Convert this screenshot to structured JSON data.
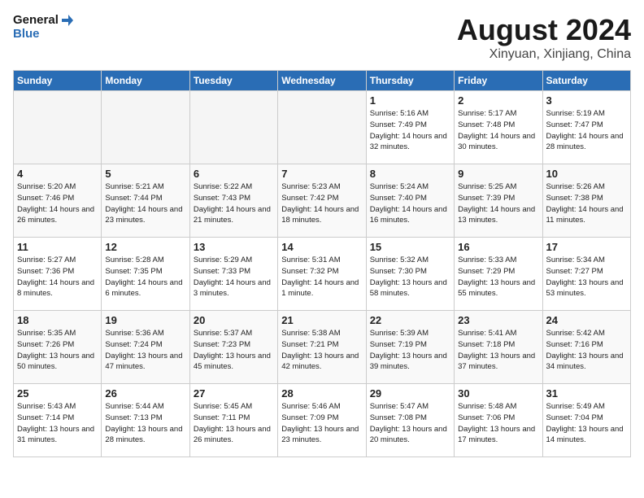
{
  "logo": {
    "line1": "General",
    "line2": "Blue"
  },
  "title": "August 2024",
  "location": "Xinyuan, Xinjiang, China",
  "weekdays": [
    "Sunday",
    "Monday",
    "Tuesday",
    "Wednesday",
    "Thursday",
    "Friday",
    "Saturday"
  ],
  "weeks": [
    [
      {
        "day": "",
        "empty": true
      },
      {
        "day": "",
        "empty": true
      },
      {
        "day": "",
        "empty": true
      },
      {
        "day": "",
        "empty": true
      },
      {
        "day": "1",
        "sunrise": "5:16 AM",
        "sunset": "7:49 PM",
        "daylight": "14 hours and 32 minutes."
      },
      {
        "day": "2",
        "sunrise": "5:17 AM",
        "sunset": "7:48 PM",
        "daylight": "14 hours and 30 minutes."
      },
      {
        "day": "3",
        "sunrise": "5:19 AM",
        "sunset": "7:47 PM",
        "daylight": "14 hours and 28 minutes."
      }
    ],
    [
      {
        "day": "4",
        "sunrise": "5:20 AM",
        "sunset": "7:46 PM",
        "daylight": "14 hours and 26 minutes."
      },
      {
        "day": "5",
        "sunrise": "5:21 AM",
        "sunset": "7:44 PM",
        "daylight": "14 hours and 23 minutes."
      },
      {
        "day": "6",
        "sunrise": "5:22 AM",
        "sunset": "7:43 PM",
        "daylight": "14 hours and 21 minutes."
      },
      {
        "day": "7",
        "sunrise": "5:23 AM",
        "sunset": "7:42 PM",
        "daylight": "14 hours and 18 minutes."
      },
      {
        "day": "8",
        "sunrise": "5:24 AM",
        "sunset": "7:40 PM",
        "daylight": "14 hours and 16 minutes."
      },
      {
        "day": "9",
        "sunrise": "5:25 AM",
        "sunset": "7:39 PM",
        "daylight": "14 hours and 13 minutes."
      },
      {
        "day": "10",
        "sunrise": "5:26 AM",
        "sunset": "7:38 PM",
        "daylight": "14 hours and 11 minutes."
      }
    ],
    [
      {
        "day": "11",
        "sunrise": "5:27 AM",
        "sunset": "7:36 PM",
        "daylight": "14 hours and 8 minutes."
      },
      {
        "day": "12",
        "sunrise": "5:28 AM",
        "sunset": "7:35 PM",
        "daylight": "14 hours and 6 minutes."
      },
      {
        "day": "13",
        "sunrise": "5:29 AM",
        "sunset": "7:33 PM",
        "daylight": "14 hours and 3 minutes."
      },
      {
        "day": "14",
        "sunrise": "5:31 AM",
        "sunset": "7:32 PM",
        "daylight": "14 hours and 1 minute."
      },
      {
        "day": "15",
        "sunrise": "5:32 AM",
        "sunset": "7:30 PM",
        "daylight": "13 hours and 58 minutes."
      },
      {
        "day": "16",
        "sunrise": "5:33 AM",
        "sunset": "7:29 PM",
        "daylight": "13 hours and 55 minutes."
      },
      {
        "day": "17",
        "sunrise": "5:34 AM",
        "sunset": "7:27 PM",
        "daylight": "13 hours and 53 minutes."
      }
    ],
    [
      {
        "day": "18",
        "sunrise": "5:35 AM",
        "sunset": "7:26 PM",
        "daylight": "13 hours and 50 minutes."
      },
      {
        "day": "19",
        "sunrise": "5:36 AM",
        "sunset": "7:24 PM",
        "daylight": "13 hours and 47 minutes."
      },
      {
        "day": "20",
        "sunrise": "5:37 AM",
        "sunset": "7:23 PM",
        "daylight": "13 hours and 45 minutes."
      },
      {
        "day": "21",
        "sunrise": "5:38 AM",
        "sunset": "7:21 PM",
        "daylight": "13 hours and 42 minutes."
      },
      {
        "day": "22",
        "sunrise": "5:39 AM",
        "sunset": "7:19 PM",
        "daylight": "13 hours and 39 minutes."
      },
      {
        "day": "23",
        "sunrise": "5:41 AM",
        "sunset": "7:18 PM",
        "daylight": "13 hours and 37 minutes."
      },
      {
        "day": "24",
        "sunrise": "5:42 AM",
        "sunset": "7:16 PM",
        "daylight": "13 hours and 34 minutes."
      }
    ],
    [
      {
        "day": "25",
        "sunrise": "5:43 AM",
        "sunset": "7:14 PM",
        "daylight": "13 hours and 31 minutes."
      },
      {
        "day": "26",
        "sunrise": "5:44 AM",
        "sunset": "7:13 PM",
        "daylight": "13 hours and 28 minutes."
      },
      {
        "day": "27",
        "sunrise": "5:45 AM",
        "sunset": "7:11 PM",
        "daylight": "13 hours and 26 minutes."
      },
      {
        "day": "28",
        "sunrise": "5:46 AM",
        "sunset": "7:09 PM",
        "daylight": "13 hours and 23 minutes."
      },
      {
        "day": "29",
        "sunrise": "5:47 AM",
        "sunset": "7:08 PM",
        "daylight": "13 hours and 20 minutes."
      },
      {
        "day": "30",
        "sunrise": "5:48 AM",
        "sunset": "7:06 PM",
        "daylight": "13 hours and 17 minutes."
      },
      {
        "day": "31",
        "sunrise": "5:49 AM",
        "sunset": "7:04 PM",
        "daylight": "13 hours and 14 minutes."
      }
    ]
  ],
  "labels": {
    "sunrise": "Sunrise:",
    "sunset": "Sunset:",
    "daylight": "Daylight:"
  }
}
